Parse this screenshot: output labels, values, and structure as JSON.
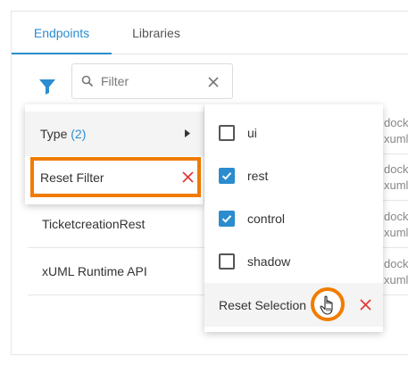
{
  "tabs": [
    {
      "label": "Endpoints",
      "active": true
    },
    {
      "label": "Libraries",
      "active": false
    }
  ],
  "filter": {
    "placeholder": "Filter",
    "value": ""
  },
  "rows": [
    {
      "name": "",
      "tail_lines": [
        "dock",
        "xuml"
      ]
    },
    {
      "name": "",
      "tail_lines": [
        "dock",
        "xuml"
      ]
    },
    {
      "name": "TicketcreationRest",
      "tail_lines": [
        "dock",
        "xuml"
      ]
    },
    {
      "name": "xUML Runtime API",
      "tail_lines": [
        "dock",
        "xuml"
      ]
    }
  ],
  "filter_menu": {
    "type_label": "Type",
    "type_count": "(2)",
    "reset_filter_label": "Reset Filter"
  },
  "type_menu": {
    "options": [
      {
        "label": "ui",
        "checked": false
      },
      {
        "label": "rest",
        "checked": true
      },
      {
        "label": "control",
        "checked": true
      },
      {
        "label": "shadow",
        "checked": false
      }
    ],
    "reset_selection_label": "Reset Selection"
  },
  "colors": {
    "accent": "#2b8ccf",
    "highlight": "#f07c00",
    "danger": "#e53935"
  },
  "icons": [
    "filter-icon",
    "search-icon",
    "clear-icon",
    "chevron-right-icon",
    "close-icon",
    "hand-pointer-icon",
    "checkbox-checked-icon"
  ]
}
